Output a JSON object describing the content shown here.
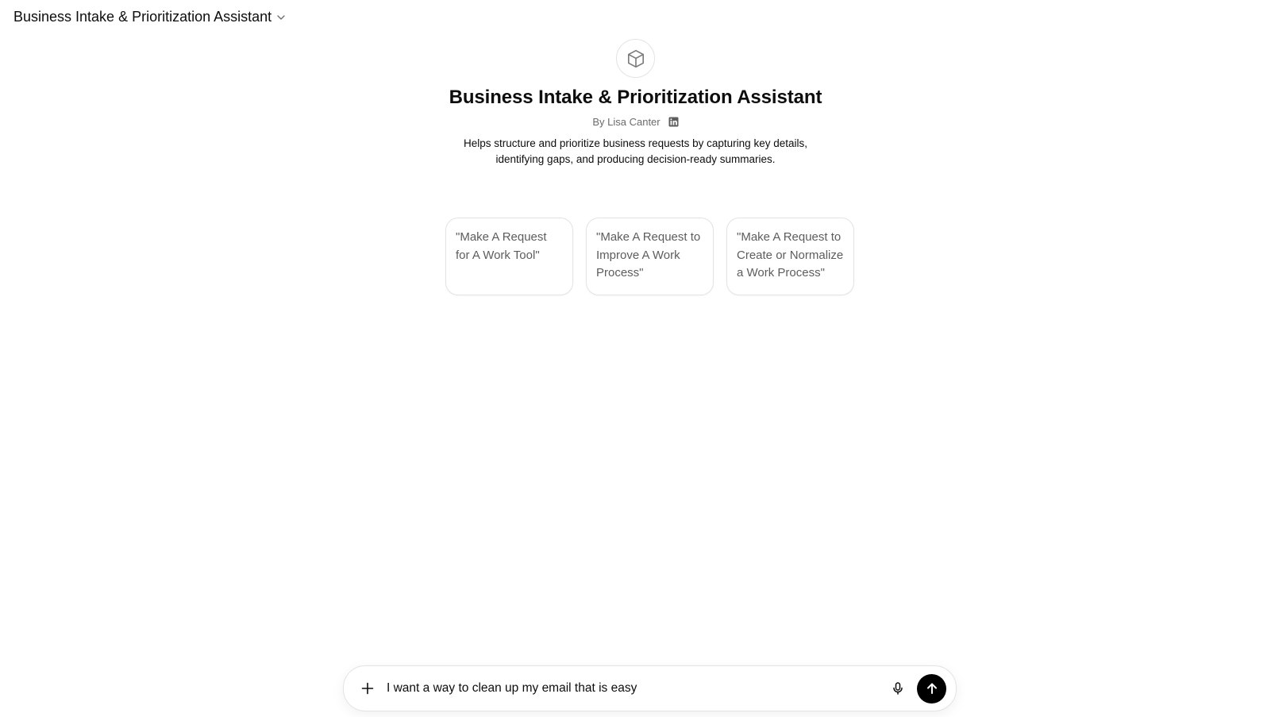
{
  "header": {
    "title": "Business Intake & Prioritization Assistant",
    "dropdown_icon": "chevron-down-icon"
  },
  "gpt": {
    "icon": "cube-icon",
    "title": "Business Intake & Prioritization Assistant",
    "byline": "By Lisa Canter",
    "byline_icon": "linkedin-icon",
    "description": "Helps structure and prioritize business requests by capturing key details, identifying gaps, and producing decision-ready summaries."
  },
  "starters": [
    {
      "label": "\"Make A Request for A Work Tool\""
    },
    {
      "label": "\"Make A Request to Improve A Work Process\""
    },
    {
      "label": "\"Make A Request to Create or Normalize a Work Process\""
    }
  ],
  "composer": {
    "value": "I want a way to clean up my email that is easy",
    "attach_icon": "plus-icon",
    "mic_icon": "microphone-icon",
    "send_icon": "arrow-up-icon"
  },
  "colors": {
    "send_button": "#000000",
    "border": "#e3e3e3",
    "muted_text": "#5d5d5d"
  }
}
